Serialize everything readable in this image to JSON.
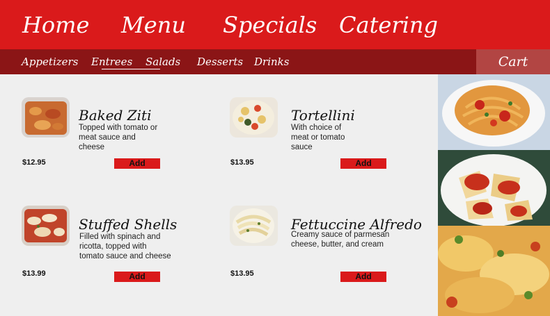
{
  "top_nav": {
    "items": [
      "Home",
      "Menu",
      "Specials",
      "Catering"
    ]
  },
  "sub_nav": {
    "items": [
      "Appetizers",
      "Entrees",
      "Salads",
      "Desserts",
      "Drinks"
    ],
    "cart_label": "Cart"
  },
  "menu_items": [
    {
      "name": "Baked Ziti",
      "description": "Topped with tomato or meat sauce and cheese",
      "price": "$12.95",
      "button_label": "Add"
    },
    {
      "name": "Tortellini",
      "description": "With choice of meat or tomato sauce",
      "price": "$13.95",
      "button_label": "Add"
    },
    {
      "name": "Stuffed Shells",
      "description": "Filled with spinach and ricotta, topped with tomato sauce and cheese",
      "price": "$13.99",
      "button_label": "Add"
    },
    {
      "name": "Fettuccine Alfredo",
      "description": "Creamy sauce of parmesan cheese, butter, and cream",
      "price": "$13.95",
      "button_label": "Add"
    }
  ],
  "colors": {
    "header_red": "#da1a1b",
    "subnav_dark_red": "#8b1516",
    "cart_bg": "#b24543",
    "page_bg": "#efefef"
  }
}
